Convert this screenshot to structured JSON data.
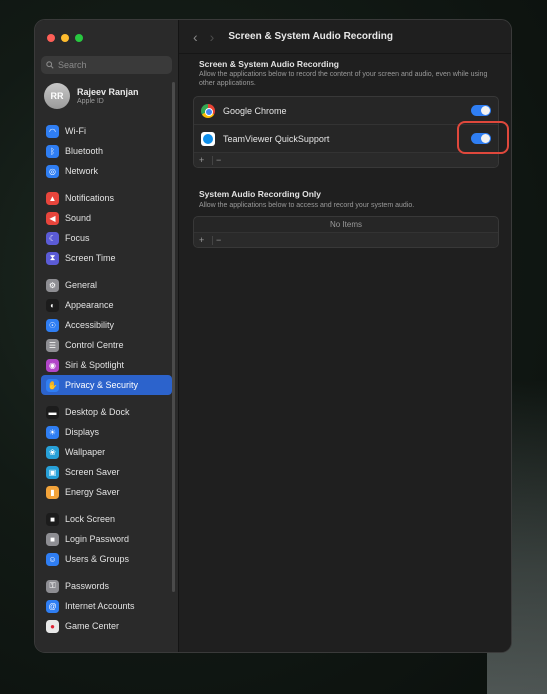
{
  "window": {
    "title": "Screen & System Audio Recording"
  },
  "sidebar": {
    "search_placeholder": "Search",
    "user": {
      "initials": "RR",
      "name": "Rajeev Ranjan",
      "subtitle": "Apple ID"
    },
    "groups": [
      [
        {
          "label": "Wi-Fi",
          "icon": "wifi-icon",
          "color": "#2f7ef3"
        },
        {
          "label": "Bluetooth",
          "icon": "bluetooth-icon",
          "color": "#2f7ef3"
        },
        {
          "label": "Network",
          "icon": "globe-icon",
          "color": "#2f7ef3"
        }
      ],
      [
        {
          "label": "Notifications",
          "icon": "bell-icon",
          "color": "#e8453c"
        },
        {
          "label": "Sound",
          "icon": "speaker-icon",
          "color": "#e8453c"
        },
        {
          "label": "Focus",
          "icon": "moon-icon",
          "color": "#5b5bd6"
        },
        {
          "label": "Screen Time",
          "icon": "hourglass-icon",
          "color": "#5b5bd6"
        }
      ],
      [
        {
          "label": "General",
          "icon": "gear-icon",
          "color": "#8e8e93"
        },
        {
          "label": "Appearance",
          "icon": "appearance-icon",
          "color": "#1c1c1c"
        },
        {
          "label": "Accessibility",
          "icon": "accessibility-icon",
          "color": "#2f7ef3"
        },
        {
          "label": "Control Centre",
          "icon": "control-centre-icon",
          "color": "#8e8e93"
        },
        {
          "label": "Siri & Spotlight",
          "icon": "siri-icon",
          "color": "#b245c9"
        },
        {
          "label": "Privacy & Security",
          "icon": "hand-icon",
          "color": "#2f7ef3",
          "active": true
        }
      ],
      [
        {
          "label": "Desktop & Dock",
          "icon": "dock-icon",
          "color": "#1c1c1c"
        },
        {
          "label": "Displays",
          "icon": "sun-icon",
          "color": "#2f7ef3"
        },
        {
          "label": "Wallpaper",
          "icon": "wallpaper-icon",
          "color": "#27a0d8"
        },
        {
          "label": "Screen Saver",
          "icon": "screen-saver-icon",
          "color": "#27a0d8"
        },
        {
          "label": "Energy Saver",
          "icon": "battery-icon",
          "color": "#f2a33a"
        }
      ],
      [
        {
          "label": "Lock Screen",
          "icon": "lock-icon",
          "color": "#1c1c1c"
        },
        {
          "label": "Login Password",
          "icon": "lock-fill-icon",
          "color": "#8e8e93"
        },
        {
          "label": "Users & Groups",
          "icon": "users-icon",
          "color": "#2f7ef3"
        }
      ],
      [
        {
          "label": "Passwords",
          "icon": "key-icon",
          "color": "#8e8e93"
        },
        {
          "label": "Internet Accounts",
          "icon": "at-icon",
          "color": "#2f7ef3"
        },
        {
          "label": "Game Center",
          "icon": "game-center-icon",
          "color": "#e8e8e8"
        }
      ]
    ]
  },
  "screen_recording": {
    "section_title": "Screen & System Audio Recording",
    "description": "Allow the applications below to record the content of your screen and audio, even while using other applications.",
    "apps": [
      {
        "name": "Google Chrome",
        "icon": "chrome-icon",
        "enabled": true
      },
      {
        "name": "TeamViewer QuickSupport",
        "icon": "teamviewer-icon",
        "enabled": true
      }
    ],
    "add_label": "+",
    "remove_label": "−"
  },
  "audio_recording": {
    "section_title": "System Audio Recording Only",
    "description": "Allow the applications below to access and record your system audio.",
    "empty_label": "No Items",
    "add_label": "+",
    "remove_label": "−"
  },
  "colors": {
    "accent": "#2f7ef3",
    "highlight": "#e0483c"
  }
}
